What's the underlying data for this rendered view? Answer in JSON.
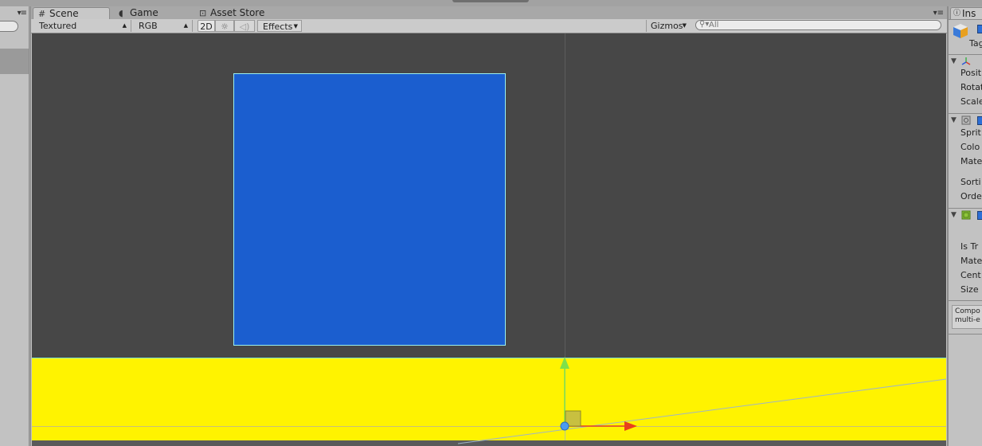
{
  "scene_tabs": {
    "scene": "Scene",
    "game": "Game",
    "asset_store": "Asset Store"
  },
  "toolbar": {
    "render_mode": "Textured",
    "color_channel": "RGB",
    "mode_2d": "2D",
    "effects": "Effects",
    "gizmos": "Gizmos",
    "search_placeholder": "All"
  },
  "inspector": {
    "tab_label": "Ins",
    "tag_label": "Tag",
    "transform": [
      "Posit",
      "Rotat",
      "Scale"
    ],
    "sprite_renderer": [
      "Sprit",
      "Colo",
      "Mate",
      "Sorti",
      "Orde"
    ],
    "box_collider": [
      "Is Tr",
      "Mate",
      "Cent",
      "Size"
    ],
    "compound_note": [
      "Compo",
      "multi-e"
    ]
  },
  "colors": {
    "viewport_bg": "#474747",
    "sprite_blue": "#1b5ecf",
    "ground_yellow": "#fff300",
    "gizmo_x": "#e8401c",
    "gizmo_y": "#7ee04a"
  },
  "icons": {
    "scene_tab": "grid-hash-icon",
    "game_tab": "pacman-icon",
    "asset_tab": "shopping-bag-icon",
    "lighting": "sun-icon",
    "audio": "speaker-icon",
    "search": "search-icon",
    "inspector_tab": "info-icon"
  }
}
